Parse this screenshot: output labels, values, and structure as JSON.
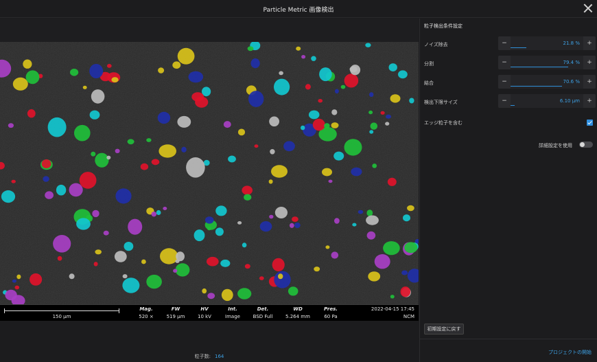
{
  "window": {
    "title": "Particle Metric 画像検出"
  },
  "sem_databar": {
    "scale_label": "150 μm",
    "fields": [
      {
        "key": "Mag.",
        "value": "520 ×"
      },
      {
        "key": "FW",
        "value": "519 μm"
      },
      {
        "key": "HV",
        "value": "10 kV"
      },
      {
        "key": "Int.",
        "value": "Image"
      },
      {
        "key": "Det.",
        "value": "BSD Full"
      },
      {
        "key": "WD",
        "value": "5.264 mm"
      },
      {
        "key": "Pres.",
        "value": "60 Pa"
      }
    ],
    "timestamp": "2022-04-15 17:45",
    "site": "NCM"
  },
  "status": {
    "count_label": "粒子数:",
    "count_value": "164"
  },
  "panel": {
    "title": "粒子検出条件設定",
    "sliders": [
      {
        "label": "ノイズ除去",
        "value": "21.8 %",
        "fraction": 0.218
      },
      {
        "label": "分割",
        "value": "79.4 %",
        "fraction": 0.794
      },
      {
        "label": "結合",
        "value": "70.6 %",
        "fraction": 0.706
      },
      {
        "label": "検出下限サイズ",
        "value": "6.10 μm",
        "fraction": 0.06
      }
    ],
    "edge_checkbox": {
      "label": "エッジ粒子を含む",
      "checked": true
    },
    "advanced_toggle": {
      "label": "詳細設定を使用",
      "on": false
    },
    "reset_label": "初期設定に戻す",
    "start_label": "プロジェクトの開始"
  },
  "particle_colors": [
    "#e0122a",
    "#1f2fa8",
    "#1fbf3a",
    "#d9c21a",
    "#12c7cf",
    "#a83fc4",
    "#bcbcbc"
  ]
}
